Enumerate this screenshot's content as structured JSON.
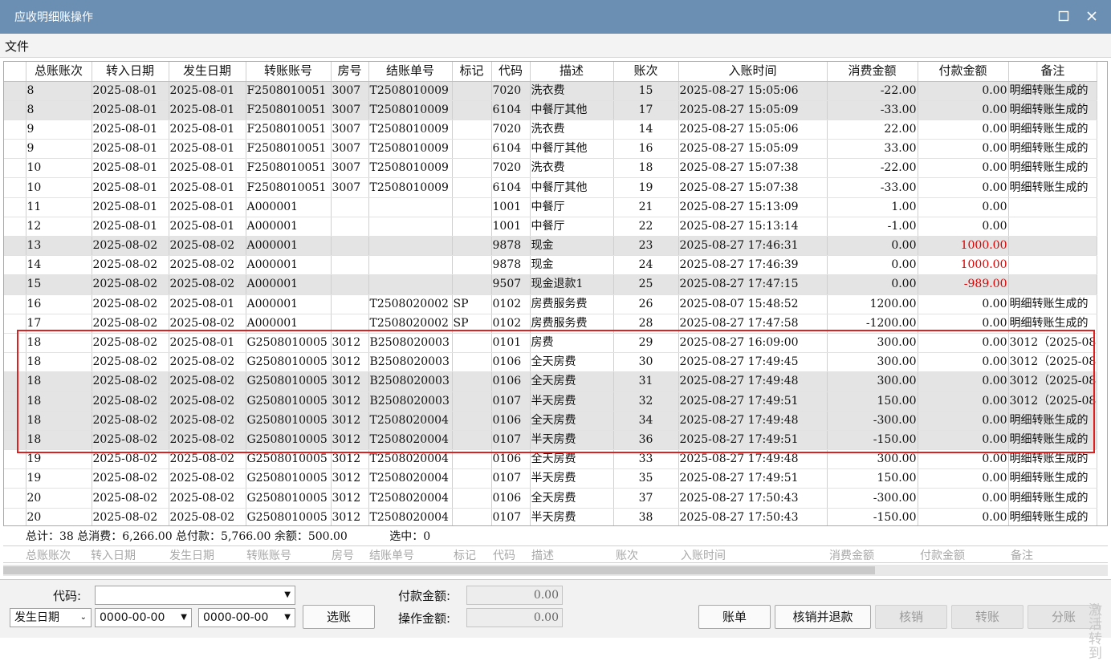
{
  "window": {
    "title": "应收明细账操作",
    "maximize_icon": "square-icon",
    "close_icon": "x-icon"
  },
  "menu": {
    "file": "文件"
  },
  "grid": {
    "columns": [
      "总账账次",
      "转入日期",
      "发生日期",
      "转账账号",
      "房号",
      "结账单号",
      "标记",
      "代码",
      "描述",
      "账次",
      "入账时间",
      "消费金额",
      "付款金额",
      "备注"
    ],
    "rows": [
      {
        "gray": true,
        "cells": [
          "8",
          "2025-08-01",
          "2025-08-01",
          "F2508010051",
          "3007",
          "T2508010009",
          "",
          "7020",
          "洗衣费",
          "15",
          "2025-08-27 15:05:06",
          "-22.00",
          "0.00",
          "明细转账生成的"
        ]
      },
      {
        "gray": true,
        "cells": [
          "8",
          "2025-08-01",
          "2025-08-01",
          "F2508010051",
          "3007",
          "T2508010009",
          "",
          "6104",
          "中餐厅其他",
          "17",
          "2025-08-27 15:05:09",
          "-33.00",
          "0.00",
          "明细转账生成的"
        ]
      },
      {
        "gray": false,
        "cells": [
          "9",
          "2025-08-01",
          "2025-08-01",
          "F2508010051",
          "3007",
          "T2508010009",
          "",
          "7020",
          "洗衣费",
          "14",
          "2025-08-27 15:05:06",
          "22.00",
          "0.00",
          "明细转账生成的"
        ]
      },
      {
        "gray": false,
        "cells": [
          "9",
          "2025-08-01",
          "2025-08-01",
          "F2508010051",
          "3007",
          "T2508010009",
          "",
          "6104",
          "中餐厅其他",
          "16",
          "2025-08-27 15:05:09",
          "33.00",
          "0.00",
          "明细转账生成的"
        ]
      },
      {
        "gray": false,
        "cells": [
          "10",
          "2025-08-01",
          "2025-08-01",
          "F2508010051",
          "3007",
          "T2508010009",
          "",
          "7020",
          "洗衣费",
          "18",
          "2025-08-27 15:07:38",
          "-22.00",
          "0.00",
          "明细转账生成的"
        ]
      },
      {
        "gray": false,
        "cells": [
          "10",
          "2025-08-01",
          "2025-08-01",
          "F2508010051",
          "3007",
          "T2508010009",
          "",
          "6104",
          "中餐厅其他",
          "19",
          "2025-08-27 15:07:38",
          "-33.00",
          "0.00",
          "明细转账生成的"
        ]
      },
      {
        "gray": false,
        "cells": [
          "11",
          "2025-08-01",
          "2025-08-01",
          "A000001",
          "",
          "",
          "",
          "1001",
          "中餐厅",
          "21",
          "2025-08-27 15:13:09",
          "1.00",
          "0.00",
          ""
        ]
      },
      {
        "gray": false,
        "cells": [
          "12",
          "2025-08-01",
          "2025-08-01",
          "A000001",
          "",
          "",
          "",
          "1001",
          "中餐厅",
          "22",
          "2025-08-27 15:13:14",
          "-1.00",
          "0.00",
          ""
        ]
      },
      {
        "gray": true,
        "red_pay": true,
        "cells": [
          "13",
          "2025-08-02",
          "2025-08-02",
          "A000001",
          "",
          "",
          "",
          "9878",
          "现金",
          "23",
          "2025-08-27 17:46:31",
          "0.00",
          "1000.00",
          ""
        ]
      },
      {
        "gray": false,
        "red_pay": true,
        "cells": [
          "14",
          "2025-08-02",
          "2025-08-02",
          "A000001",
          "",
          "",
          "",
          "9878",
          "现金",
          "24",
          "2025-08-27 17:46:39",
          "0.00",
          "1000.00",
          ""
        ]
      },
      {
        "gray": true,
        "red_pay": true,
        "cells": [
          "15",
          "2025-08-02",
          "2025-08-02",
          "A000001",
          "",
          "",
          "",
          "9507",
          "现金退款1",
          "25",
          "2025-08-27 17:47:15",
          "0.00",
          "-989.00",
          ""
        ]
      },
      {
        "gray": false,
        "cells": [
          "16",
          "2025-08-02",
          "2025-08-01",
          "A000001",
          "",
          "T2508020002",
          "SP",
          "0102",
          "房费服务费",
          "26",
          "2025-08-07 15:48:52",
          "1200.00",
          "0.00",
          "明细转账生成的"
        ]
      },
      {
        "gray": false,
        "cells": [
          "17",
          "2025-08-02",
          "2025-08-02",
          "A000001",
          "",
          "T2508020002",
          "SP",
          "0102",
          "房费服务费",
          "28",
          "2025-08-27 17:47:58",
          "-1200.00",
          "0.00",
          "明细转账生成的"
        ]
      },
      {
        "gray": false,
        "cells": [
          "18",
          "2025-08-02",
          "2025-08-01",
          "G2508010005",
          "3012",
          "B2508020003",
          "",
          "0101",
          "房费",
          "29",
          "2025-08-27 16:09:00",
          "300.00",
          "0.00",
          "3012（2025-08"
        ]
      },
      {
        "gray": false,
        "cells": [
          "18",
          "2025-08-02",
          "2025-08-02",
          "G2508010005",
          "3012",
          "B2508020003",
          "",
          "0106",
          "全天房费",
          "30",
          "2025-08-27 17:49:45",
          "300.00",
          "0.00",
          "3012（2025-08"
        ]
      },
      {
        "gray": true,
        "cells": [
          "18",
          "2025-08-02",
          "2025-08-02",
          "G2508010005",
          "3012",
          "B2508020003",
          "",
          "0106",
          "全天房费",
          "31",
          "2025-08-27 17:49:48",
          "300.00",
          "0.00",
          "3012（2025-08"
        ]
      },
      {
        "gray": true,
        "cells": [
          "18",
          "2025-08-02",
          "2025-08-02",
          "G2508010005",
          "3012",
          "B2508020003",
          "",
          "0107",
          "半天房费",
          "32",
          "2025-08-27 17:49:51",
          "150.00",
          "0.00",
          "3012（2025-08"
        ]
      },
      {
        "gray": true,
        "cells": [
          "18",
          "2025-08-02",
          "2025-08-02",
          "G2508010005",
          "3012",
          "T2508020004",
          "",
          "0106",
          "全天房费",
          "34",
          "2025-08-27 17:49:48",
          "-300.00",
          "0.00",
          "明细转账生成的"
        ]
      },
      {
        "gray": true,
        "cells": [
          "18",
          "2025-08-02",
          "2025-08-02",
          "G2508010005",
          "3012",
          "T2508020004",
          "",
          "0107",
          "半天房费",
          "36",
          "2025-08-27 17:49:51",
          "-150.00",
          "0.00",
          "明细转账生成的"
        ]
      },
      {
        "gray": false,
        "cells": [
          "19",
          "2025-08-02",
          "2025-08-02",
          "G2508010005",
          "3012",
          "T2508020004",
          "",
          "0106",
          "全天房费",
          "33",
          "2025-08-27 17:49:48",
          "300.00",
          "0.00",
          "明细转账生成的"
        ]
      },
      {
        "gray": false,
        "cells": [
          "19",
          "2025-08-02",
          "2025-08-02",
          "G2508010005",
          "3012",
          "T2508020004",
          "",
          "0107",
          "半天房费",
          "35",
          "2025-08-27 17:49:51",
          "150.00",
          "0.00",
          "明细转账生成的"
        ]
      },
      {
        "gray": false,
        "cells": [
          "20",
          "2025-08-02",
          "2025-08-02",
          "G2508010005",
          "3012",
          "T2508020004",
          "",
          "0106",
          "全天房费",
          "37",
          "2025-08-27 17:50:43",
          "-300.00",
          "0.00",
          "明细转账生成的"
        ]
      },
      {
        "gray": false,
        "cells": [
          "20",
          "2025-08-02",
          "2025-08-02",
          "G2508010005",
          "3012",
          "T2508020004",
          "",
          "0107",
          "半天房费",
          "38",
          "2025-08-27 17:50:43",
          "-150.00",
          "0.00",
          "明细转账生成的"
        ]
      }
    ]
  },
  "summary": {
    "text": "总计：38 总消费：6,266.00 总付款：5,766.00 余额：500.00",
    "selected": "选中：0"
  },
  "filter_placeholders": [
    "总账账次",
    "转入日期",
    "发生日期",
    "转账账号",
    "房号",
    "结账单号",
    "标记",
    "代码",
    "描述",
    "账次",
    "入账时间",
    "消费金额",
    "付款金额",
    "备注"
  ],
  "bottom": {
    "code_label": "代码:",
    "code_value": "",
    "date_type": "发生日期",
    "date_from": "0000-00-00",
    "date_to": "0000-00-00",
    "select_button": "选账",
    "pay_amount_label": "付款金额:",
    "pay_amount_value": "0.00",
    "op_amount_label": "操作金额:",
    "op_amount_value": "0.00",
    "buttons": [
      "账单",
      "核销并退款",
      "核销",
      "转账",
      "分账"
    ],
    "watermark": "激活 转到"
  },
  "colors": {
    "titlebar": "#6b8fb3",
    "highlight_box": "#e02020",
    "negative_pay": "#e00000"
  }
}
